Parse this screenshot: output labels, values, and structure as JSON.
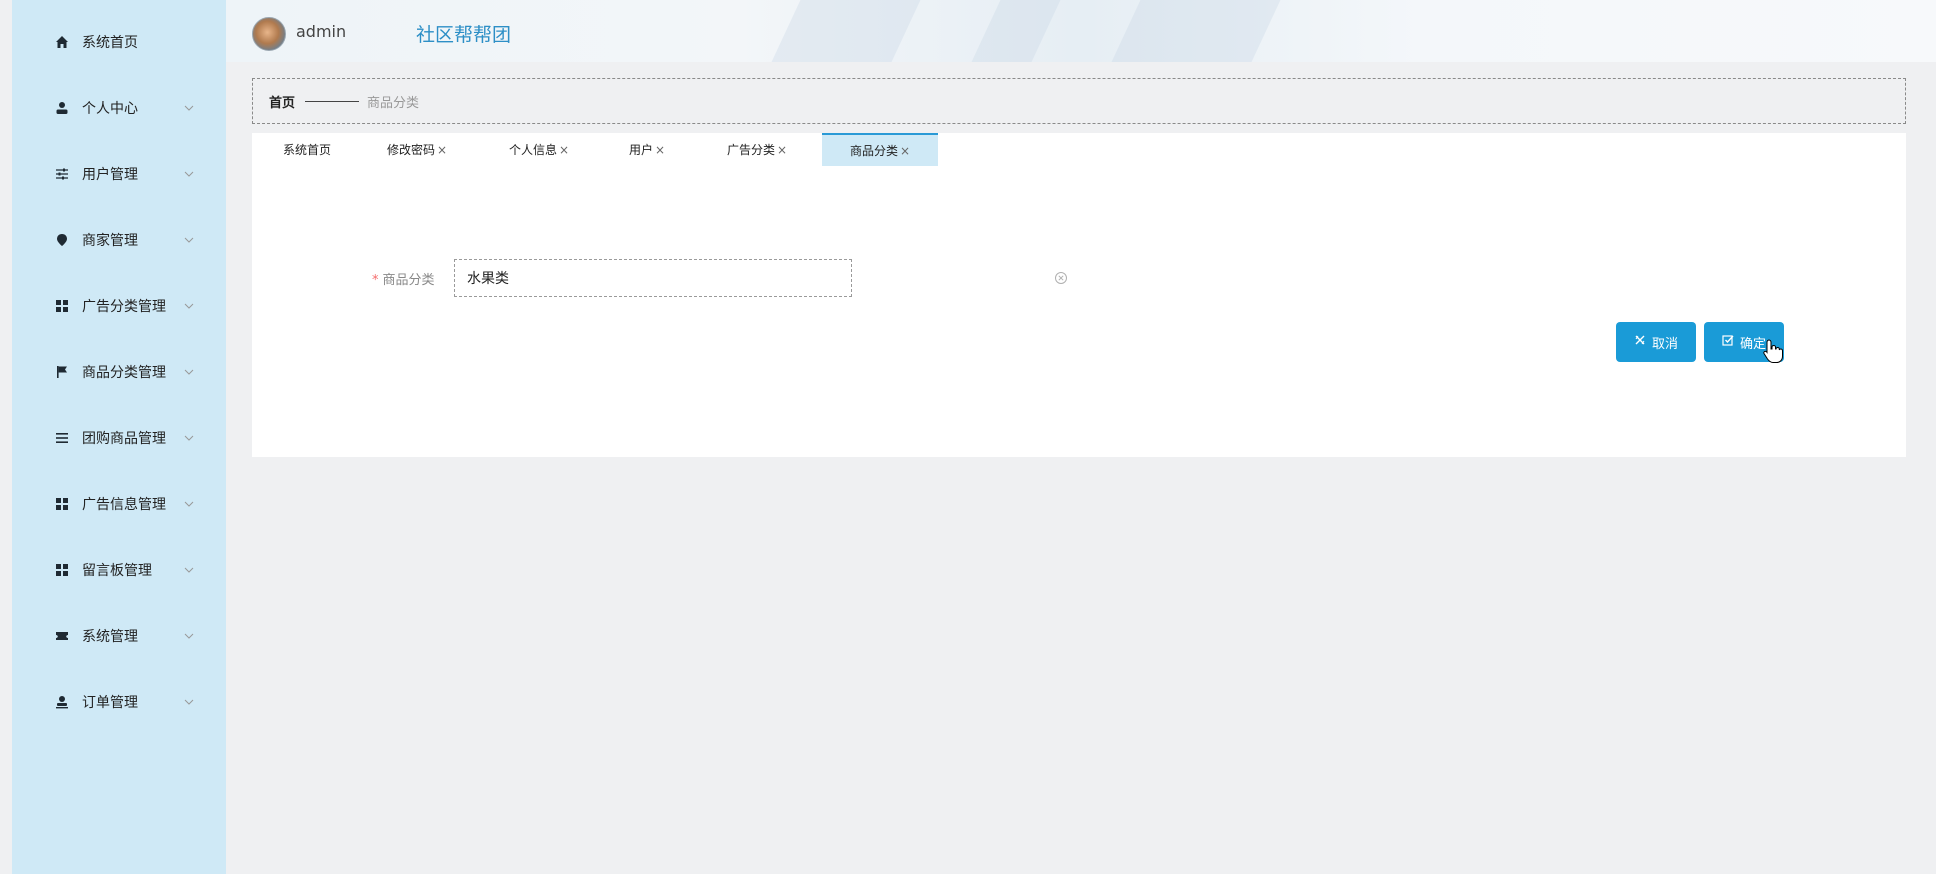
{
  "app": {
    "title": "社区帮帮团"
  },
  "header": {
    "username": "admin"
  },
  "sidebar": {
    "items": [
      {
        "label": "系统首页",
        "icon": "home-icon",
        "has_chevron": false
      },
      {
        "label": "个人中心",
        "icon": "user-icon",
        "has_chevron": true
      },
      {
        "label": "用户管理",
        "icon": "sliders-icon",
        "has_chevron": true
      },
      {
        "label": "商家管理",
        "icon": "location-pin-icon",
        "has_chevron": true
      },
      {
        "label": "广告分类管理",
        "icon": "grid-icon",
        "has_chevron": true
      },
      {
        "label": "商品分类管理",
        "icon": "flag-icon",
        "has_chevron": true
      },
      {
        "label": "团购商品管理",
        "icon": "list-icon",
        "has_chevron": true
      },
      {
        "label": "广告信息管理",
        "icon": "grid-icon",
        "has_chevron": true
      },
      {
        "label": "留言板管理",
        "icon": "grid-icon",
        "has_chevron": true
      },
      {
        "label": "系统管理",
        "icon": "ticket-icon",
        "has_chevron": true
      },
      {
        "label": "订单管理",
        "icon": "user-upload-icon",
        "has_chevron": true
      }
    ]
  },
  "breadcrumb": {
    "home": "首页",
    "current": "商品分类"
  },
  "tabs": [
    {
      "label": "系统首页",
      "closable": false,
      "active": false
    },
    {
      "label": "修改密码",
      "closable": true,
      "active": false
    },
    {
      "label": "个人信息",
      "closable": true,
      "active": false
    },
    {
      "label": "用户",
      "closable": true,
      "active": false
    },
    {
      "label": "广告分类",
      "closable": true,
      "active": false
    },
    {
      "label": "商品分类",
      "closable": true,
      "active": true
    }
  ],
  "tab_close_glyph": "×",
  "form": {
    "required_mark": "*",
    "field_label": "商品分类",
    "field_value": "水果类"
  },
  "buttons": {
    "cancel": "取消",
    "confirm": "确定"
  },
  "colors": {
    "accent": "#1a9bd7",
    "sidebar_bg": "#cfe9f6",
    "title": "#2d8fc6",
    "required": "#f56c6c"
  }
}
